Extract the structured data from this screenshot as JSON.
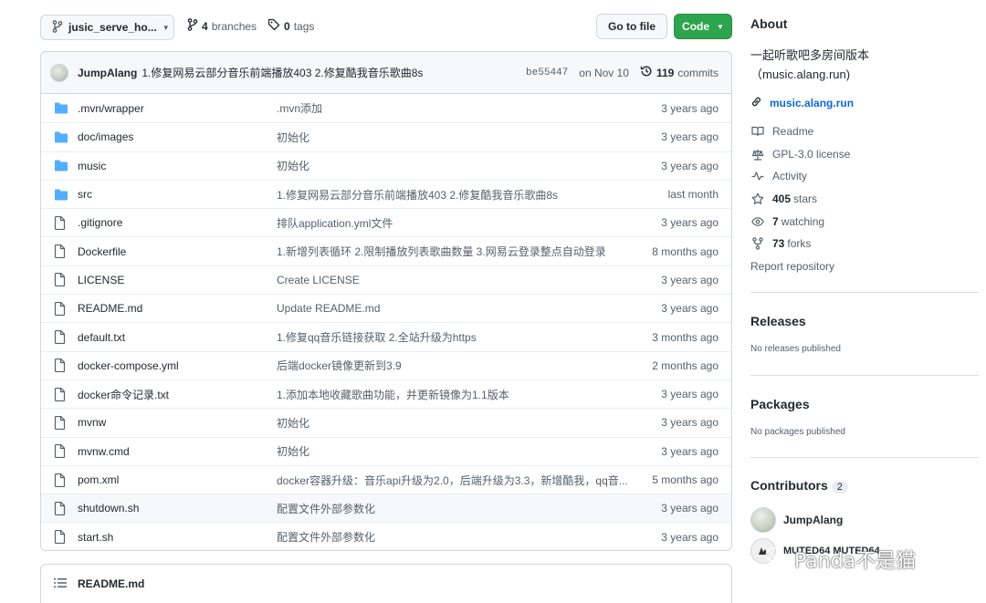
{
  "toolbar": {
    "branch_name": "jusic_serve_ho...",
    "branches_count": "4",
    "branches_label": "branches",
    "tags_count": "0",
    "tags_label": "tags",
    "goto_file_label": "Go to file",
    "code_label": "Code"
  },
  "latest_commit": {
    "author": "JumpAlang",
    "message": "1.修复网易云部分音乐前端播放403 2.修复酷我音乐歌曲8s",
    "sha": "be55447",
    "date": "on Nov 10",
    "commits_count": "119",
    "commits_label": "commits"
  },
  "files": [
    {
      "type": "folder",
      "name": ".mvn/wrapper",
      "commit": ".mvn添加",
      "time": "3 years ago"
    },
    {
      "type": "folder",
      "name": "doc/images",
      "commit": "初始化",
      "time": "3 years ago"
    },
    {
      "type": "folder",
      "name": "music",
      "commit": "初始化",
      "time": "3 years ago"
    },
    {
      "type": "folder",
      "name": "src",
      "commit": "1.修复网易云部分音乐前端播放403 2.修复酷我音乐歌曲8s",
      "time": "last month"
    },
    {
      "type": "file",
      "name": ".gitignore",
      "commit": "排队application.yml文件",
      "time": "3 years ago"
    },
    {
      "type": "file",
      "name": "Dockerfile",
      "commit": "1.新增列表循环 2.限制播放列表歌曲数量 3.网易云登录整点自动登录",
      "time": "8 months ago"
    },
    {
      "type": "file",
      "name": "LICENSE",
      "commit": "Create LICENSE",
      "time": "3 years ago"
    },
    {
      "type": "file",
      "name": "README.md",
      "commit": "Update README.md",
      "time": "3 years ago"
    },
    {
      "type": "file",
      "name": "default.txt",
      "commit": "1.修复qq音乐链接获取 2.全站升级为https",
      "time": "3 months ago"
    },
    {
      "type": "file",
      "name": "docker-compose.yml",
      "commit": "后端docker镜像更新到3.9",
      "time": "2 months ago"
    },
    {
      "type": "file",
      "name": "docker命令记录.txt",
      "commit": "1.添加本地收藏歌曲功能，并更新镜像为1.1版本",
      "time": "3 years ago"
    },
    {
      "type": "file",
      "name": "mvnw",
      "commit": "初始化",
      "time": "3 years ago"
    },
    {
      "type": "file",
      "name": "mvnw.cmd",
      "commit": "初始化",
      "time": "3 years ago"
    },
    {
      "type": "file",
      "name": "pom.xml",
      "commit": "docker容器升级：音乐api升级为2.0，后端升级为3.3，新增酷我，qq音...",
      "time": "5 months ago"
    },
    {
      "type": "file",
      "name": "shutdown.sh",
      "commit": "配置文件外部参数化",
      "time": "3 years ago"
    },
    {
      "type": "file",
      "name": "start.sh",
      "commit": "配置文件外部参数化",
      "time": "3 years ago"
    }
  ],
  "readme": {
    "title": "README.md"
  },
  "about": {
    "heading": "About",
    "description": "一起听歌吧多房间版本（music.alang.run)",
    "website": "music.alang.run",
    "readme_label": "Readme",
    "license_label": "GPL-3.0 license",
    "activity_label": "Activity",
    "stars_count": "405",
    "stars_label": "stars",
    "watching_count": "7",
    "watching_label": "watching",
    "forks_count": "73",
    "forks_label": "forks",
    "report_label": "Report repository"
  },
  "releases": {
    "heading": "Releases",
    "empty": "No releases published"
  },
  "packages": {
    "heading": "Packages",
    "empty": "No packages published"
  },
  "contributors": {
    "heading": "Contributors",
    "count": "2",
    "list": [
      {
        "name": "JumpAlang"
      },
      {
        "name": "MUTED64 MUTED64"
      }
    ]
  },
  "watermark": {
    "text": "Panda不是猫"
  },
  "colors": {
    "accent": "#0969da",
    "code_button": "#2da44e",
    "folder": "#54aeff",
    "muted": "#57606a"
  }
}
